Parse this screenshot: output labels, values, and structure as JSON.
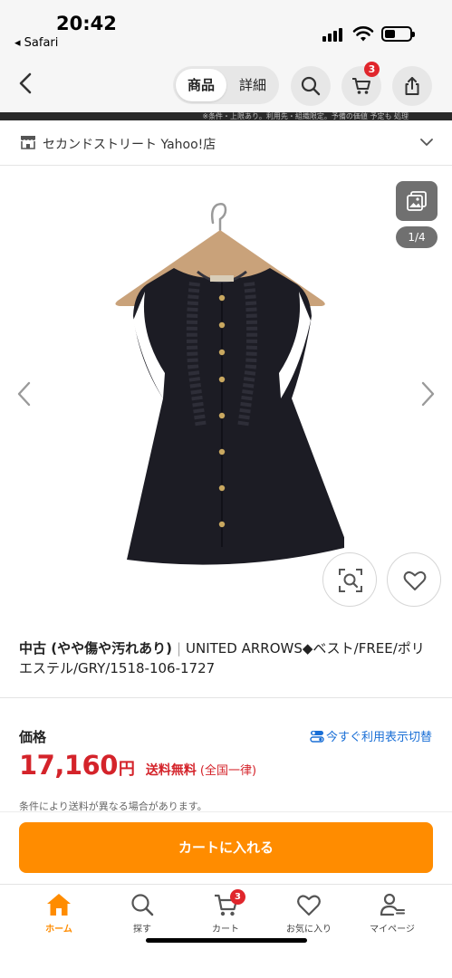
{
  "status_bar": {
    "time": "20:42",
    "back_app": "◂ Safari"
  },
  "nav": {
    "tabs": [
      {
        "label": "商品",
        "active": true
      },
      {
        "label": "詳細",
        "active": false
      }
    ],
    "cart_count": "3",
    "icons": [
      "back-chevron-icon",
      "search-icon",
      "cart-icon",
      "share-icon"
    ]
  },
  "notice_strip": "※条件・上限あり。利用先・組織限定。予備の価値 予定も 処理 ",
  "store": {
    "name": "セカンドストリート Yahoo!店"
  },
  "gallery": {
    "counter": "1/4"
  },
  "product": {
    "condition": "中古 (やや傷や汚れあり)",
    "separator": "|",
    "title": "UNITED ARROWS◆ベスト/FREE/ポリエステル/GRY/1518-106-1727"
  },
  "price": {
    "label": "価格",
    "switch_link": "今すぐ利用表示切替",
    "value": "17,160",
    "unit": "円",
    "shipping": "送料無料",
    "shipping_sub": "(全国一律)",
    "shipping_note": "条件により送料が異なる場合があります。"
  },
  "cart_button": "カートに入れる",
  "tab_bar": {
    "items": [
      {
        "label": "ホーム",
        "icon": "home-icon",
        "active": true
      },
      {
        "label": "探す",
        "icon": "search-icon",
        "active": false
      },
      {
        "label": "カート",
        "icon": "cart-icon",
        "active": false,
        "badge": "3"
      },
      {
        "label": "お気に入り",
        "icon": "heart-icon",
        "active": false
      },
      {
        "label": "マイページ",
        "icon": "user-icon",
        "active": false
      }
    ]
  },
  "colors": {
    "accent_orange": "#ff8c00",
    "price_red": "#d4232a",
    "badge_red": "#e0262c",
    "link_blue": "#1a6fd6"
  }
}
